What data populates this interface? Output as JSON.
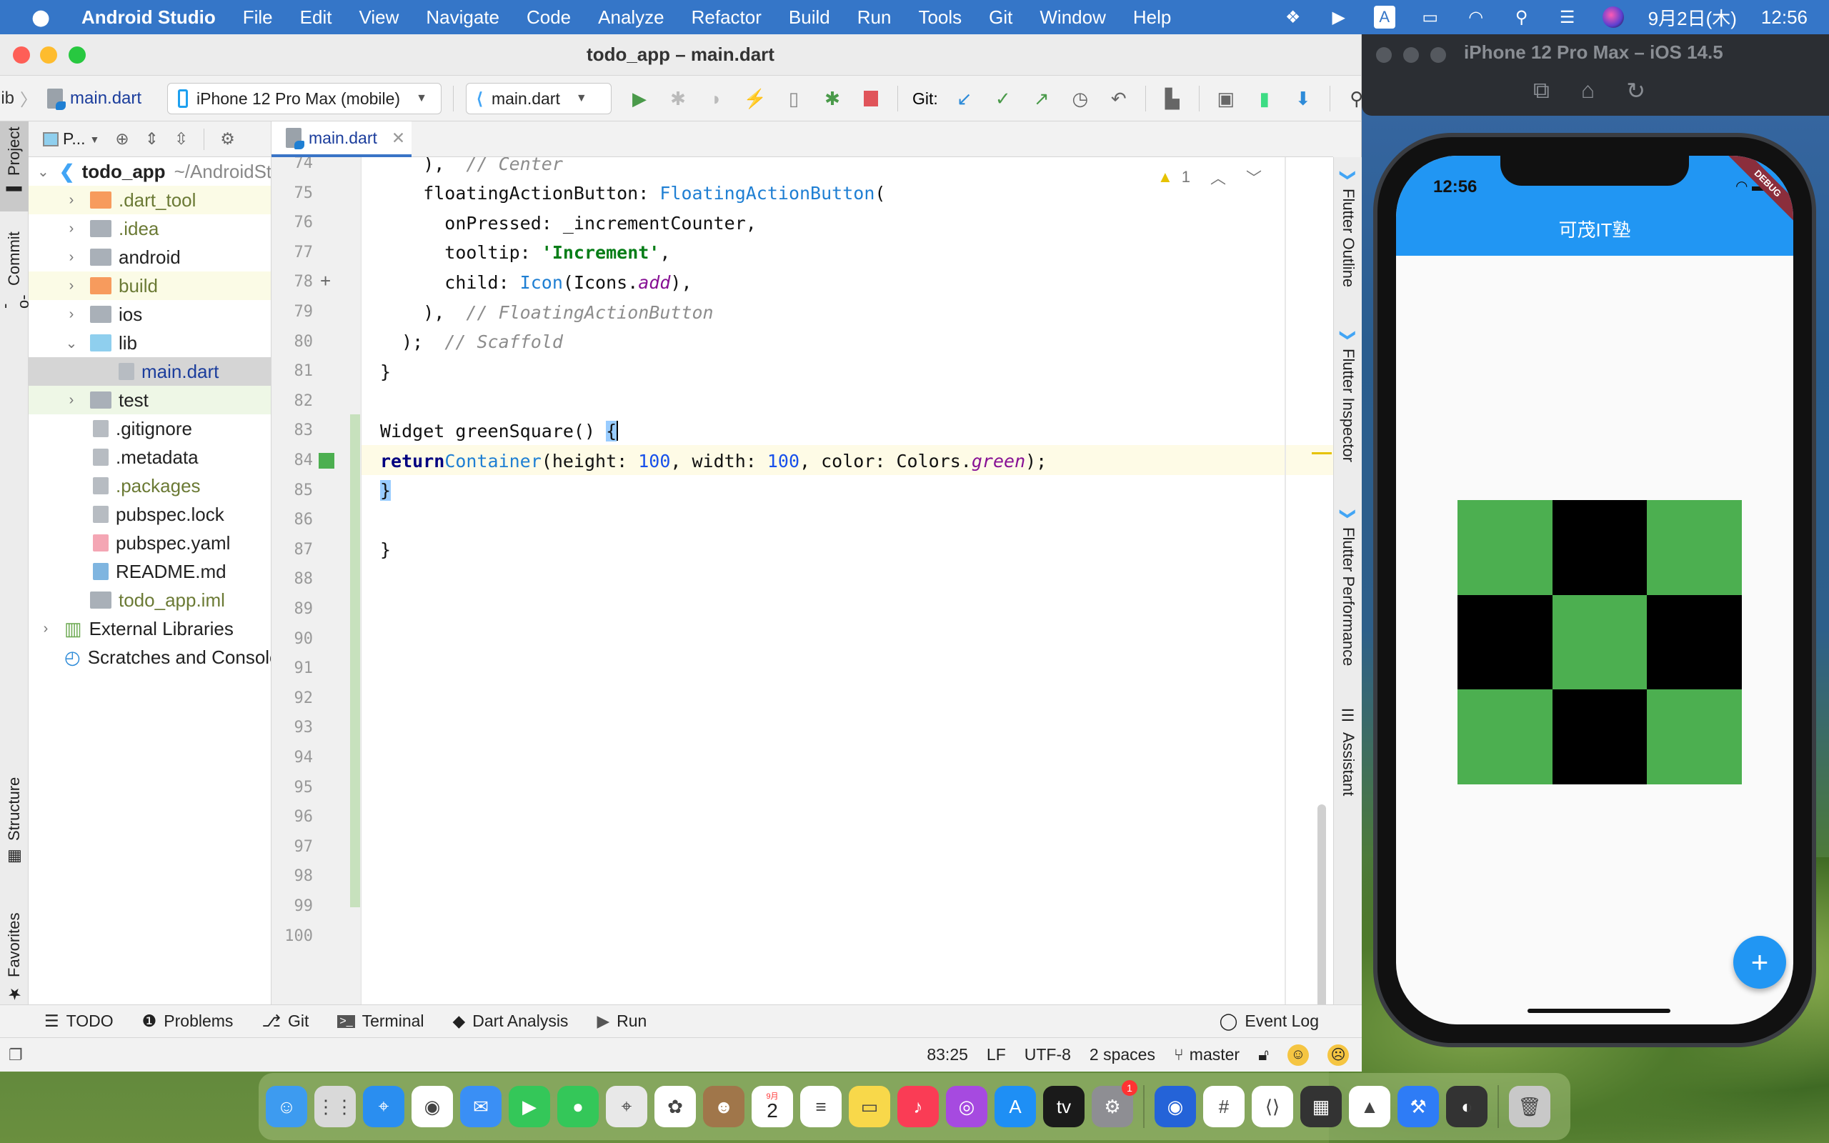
{
  "menubar": {
    "app_name": "Android Studio",
    "items": [
      "File",
      "Edit",
      "View",
      "Navigate",
      "Code",
      "Analyze",
      "Refactor",
      "Build",
      "Run",
      "Tools",
      "Git",
      "Window",
      "Help"
    ],
    "status_icons": [
      "dropbox-icon",
      "play-circle-icon",
      "input-method-icon",
      "battery-icon",
      "wifi-icon",
      "spotlight-icon",
      "control-center-icon",
      "siri-icon"
    ],
    "input_method": "A",
    "date": "9月2日(木)",
    "time": "12:56"
  },
  "ide": {
    "window_title": "todo_app – main.dart",
    "breadcrumb": {
      "parent": "lib",
      "file": "main.dart"
    },
    "device_selector": "iPhone 12 Pro Max (mobile)",
    "run_config": "main.dart",
    "git_label": "Git:",
    "left_tabs": [
      "Project",
      "Commit",
      "Structure",
      "Favorites"
    ],
    "right_tabs": [
      "Flutter Outline",
      "Flutter Inspector",
      "Flutter Performance",
      "Assistant"
    ],
    "project_panel": {
      "view_label": "P...",
      "root": {
        "name": "todo_app",
        "path": "~/AndroidStudioProjects/todo_app"
      },
      "items": [
        {
          "name": ".dart_tool",
          "type": "folder-excluded",
          "depth": 1,
          "expandable": true
        },
        {
          "name": ".idea",
          "type": "folder-config",
          "depth": 1,
          "expandable": true
        },
        {
          "name": "android",
          "type": "folder-module",
          "depth": 1,
          "expandable": true
        },
        {
          "name": "build",
          "type": "folder-excluded",
          "depth": 1,
          "expandable": true
        },
        {
          "name": "ios",
          "type": "folder-module",
          "depth": 1,
          "expandable": true
        },
        {
          "name": "lib",
          "type": "folder-source",
          "depth": 1,
          "expanded": true
        },
        {
          "name": "main.dart",
          "type": "dart-file",
          "depth": 2,
          "selected": true
        },
        {
          "name": "test",
          "type": "folder-test",
          "depth": 1,
          "expandable": true
        },
        {
          "name": ".gitignore",
          "type": "ignore-file",
          "depth": 1
        },
        {
          "name": ".metadata",
          "type": "text-file",
          "depth": 1
        },
        {
          "name": ".packages",
          "type": "text-file",
          "depth": 1
        },
        {
          "name": "pubspec.lock",
          "type": "text-file",
          "depth": 1
        },
        {
          "name": "pubspec.yaml",
          "type": "yaml-file",
          "depth": 1
        },
        {
          "name": "README.md",
          "type": "md-file",
          "depth": 1
        },
        {
          "name": "todo_app.iml",
          "type": "iml-file",
          "depth": 1
        }
      ],
      "external_libraries": "External Libraries",
      "scratches": "Scratches and Consoles"
    },
    "editor": {
      "tab": "main.dart",
      "warnings": "1",
      "lines": [
        {
          "n": "74",
          "text": "    ),  // Center"
        },
        {
          "n": "75",
          "text": "    floatingActionButton: FloatingActionButton("
        },
        {
          "n": "76",
          "text": "      onPressed: _incrementCounter,"
        },
        {
          "n": "77",
          "text": "      tooltip: 'Increment',"
        },
        {
          "n": "78",
          "text": "      child: Icon(Icons.add),"
        },
        {
          "n": "79",
          "text": "    ),  // FloatingActionButton"
        },
        {
          "n": "80",
          "text": "  );  // Scaffold"
        },
        {
          "n": "81",
          "text": "}"
        },
        {
          "n": "82",
          "text": ""
        },
        {
          "n": "83",
          "text": "Widget greenSquare() {"
        },
        {
          "n": "84",
          "text": "  return Container(height: 100, width: 100, color: Colors.green);"
        },
        {
          "n": "85",
          "text": "}"
        },
        {
          "n": "86",
          "text": ""
        },
        {
          "n": "87",
          "text": "}"
        },
        {
          "n": "88",
          "text": ""
        },
        {
          "n": "89",
          "text": ""
        },
        {
          "n": "90",
          "text": ""
        },
        {
          "n": "91",
          "text": ""
        },
        {
          "n": "92",
          "text": ""
        },
        {
          "n": "93",
          "text": ""
        },
        {
          "n": "94",
          "text": ""
        },
        {
          "n": "95",
          "text": ""
        },
        {
          "n": "96",
          "text": ""
        },
        {
          "n": "97",
          "text": ""
        },
        {
          "n": "98",
          "text": ""
        },
        {
          "n": "99",
          "text": ""
        },
        {
          "n": "100",
          "text": ""
        }
      ],
      "current_line": "83",
      "color_swatch": "#4caf50"
    },
    "tool_windows": [
      "TODO",
      "Problems",
      "Git",
      "Terminal",
      "Dart Analysis",
      "Run"
    ],
    "event_log": "Event Log",
    "status": {
      "position": "83:25",
      "line_sep": "LF",
      "encoding": "UTF-8",
      "indent": "2 spaces",
      "branch": "master"
    }
  },
  "simulator": {
    "title": "iPhone 12 Pro Max – iOS 14.5",
    "toolbar": [
      "screenshot-icon",
      "home-icon",
      "rotate-icon"
    ],
    "status_time": "12:56",
    "app_title": "可茂IT塾",
    "debug_banner": "DEBUG",
    "grid": [
      "green",
      "black",
      "green",
      "black",
      "green",
      "black",
      "green",
      "black",
      "green"
    ],
    "colors": {
      "green": "#4caf50",
      "black": "#000000",
      "appbar": "#2196f3"
    },
    "fab_label": "+"
  },
  "dock": {
    "apps": [
      "Finder",
      "Launchpad",
      "Safari",
      "Chrome",
      "Mail",
      "FaceTime",
      "Messages",
      "Maps",
      "Photos",
      "Contacts",
      "Calendar",
      "Reminders",
      "Notes",
      "Music",
      "Podcasts",
      "App Store",
      "TV",
      "System Preferences",
      "Sourcetree",
      "Slack",
      "VS Code",
      "Activity Monitor",
      "Android Studio",
      "Xcode",
      "Flutter Devtools",
      "Trash"
    ],
    "calendar_month": "9月",
    "calendar_day": "2",
    "prefs_badge": "1"
  }
}
